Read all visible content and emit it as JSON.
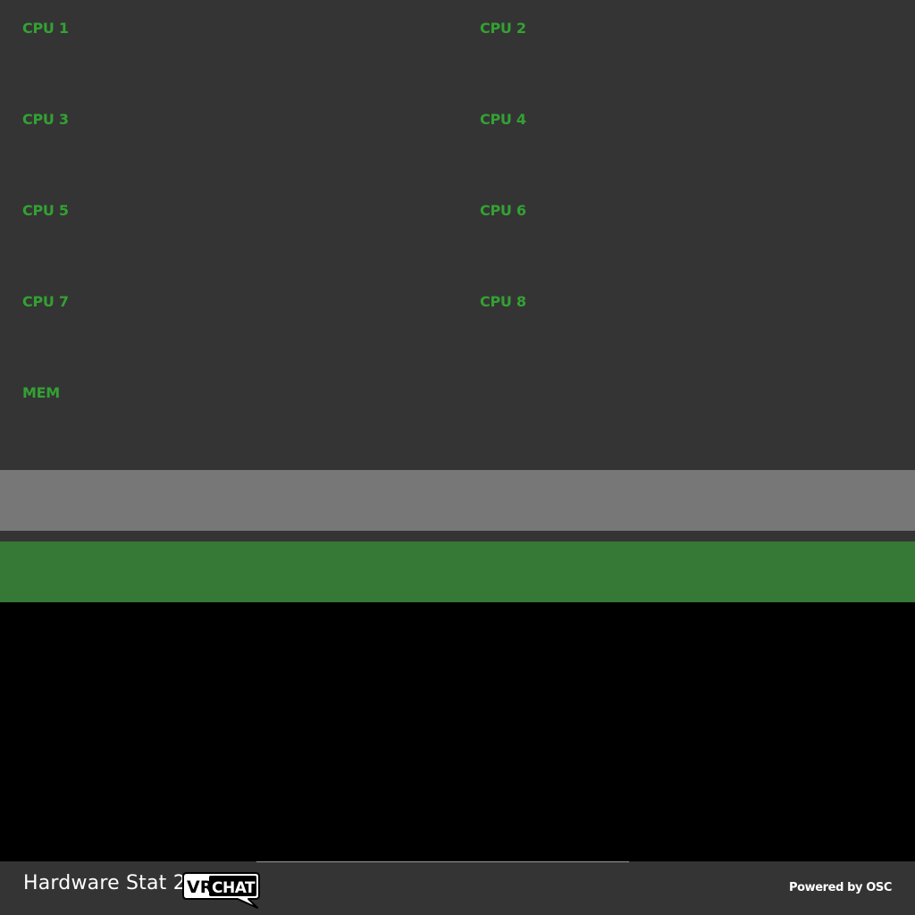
{
  "stats": {
    "cpu1": "CPU 1",
    "cpu2": "CPU 2",
    "cpu3": "CPU 3",
    "cpu4": "CPU 4",
    "cpu5": "CPU 5",
    "cpu6": "CPU 6",
    "cpu7": "CPU 7",
    "cpu8": "CPU 8",
    "mem": "MEM"
  },
  "footer": {
    "title": "Hardware Stat 2",
    "logo_vr": "VR",
    "logo_chat": "CHAT",
    "powered_by": "Powered by OSC"
  },
  "colors": {
    "panel_bg": "#343434",
    "label_green": "#33a133",
    "bar_gray": "#777777",
    "bar_green": "#367936",
    "footer_text": "#ffffff"
  },
  "icons": {
    "logo": "vrchat-logo-icon"
  }
}
